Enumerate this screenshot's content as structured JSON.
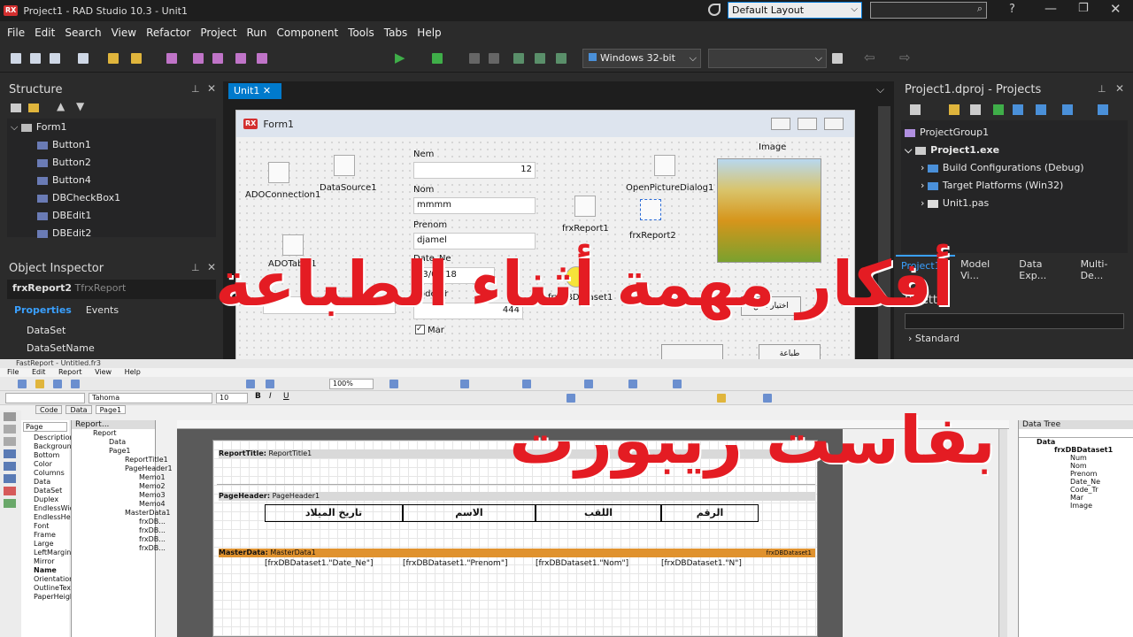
{
  "titlebar": {
    "title": "Project1 - RAD Studio 10.3 - Unit1",
    "logo": "RX",
    "layout": "Default Layout",
    "help": "?"
  },
  "menu": [
    "File",
    "Edit",
    "Search",
    "View",
    "Refactor",
    "Project",
    "Run",
    "Component",
    "Tools",
    "Tabs",
    "Help"
  ],
  "toolbar": {
    "platform": "Windows 32-bit"
  },
  "structure": {
    "title": "Structure",
    "items": [
      "Form1",
      "Button1",
      "Button2",
      "Button4",
      "DBCheckBox1",
      "DBEdit1",
      "DBEdit2"
    ]
  },
  "inspector": {
    "title": "Object Inspector",
    "selected": "frxReport2",
    "selected_type": "TfrxReport",
    "tabs": [
      "Properties",
      "Events"
    ],
    "props": [
      "DataSet",
      "DataSetName"
    ]
  },
  "editor": {
    "tab": "Unit1"
  },
  "form": {
    "title": "Form1",
    "components": {
      "adoconn": "ADOConnection1",
      "datasource": "DataSource1",
      "adotable": "ADOTable1",
      "frxreport1": "frxReport1",
      "frxreport2": "frxReport2",
      "opendlg": "OpenPictureDialog1",
      "dbdataset": "frxDBDataset1",
      "image": "Image"
    },
    "fields": {
      "num_label": "Nem",
      "num_value": "12",
      "nom_label": "Nom",
      "nom_value": "mmmm",
      "prenom_label": "Prenom",
      "prenom_value": "djamel",
      "date_label": "Date_Ne",
      "date_value": "03/04/18",
      "code_label": "Code_Tr",
      "code_value": "444",
      "mar_label": "Mar"
    },
    "buttons": {
      "choose_image": "اختيار الص",
      "print": "طباعة"
    }
  },
  "projects": {
    "title": "Project1.dproj - Projects",
    "items": [
      "ProjectGroup1",
      "Project1.exe",
      "Build Configurations (Debug)",
      "Target Platforms (Win32)",
      "Unit1.pas"
    ],
    "tabs": [
      "Project1...",
      "Model Vi...",
      "Data Exp...",
      "Multi-De..."
    ]
  },
  "palette": {
    "title": "Palette",
    "category": "Standard"
  },
  "overlay": {
    "line1": "أفكار مهمة أثناء الطباعة",
    "line2": "بفاست ريبورت"
  },
  "fastreport": {
    "title": "FastReport - Untitled.fr3",
    "menu": [
      "File",
      "Edit",
      "Report",
      "View",
      "Help"
    ],
    "zoom": "100%",
    "font": "Tahoma",
    "size": "10",
    "tabs": [
      "Code",
      "Data",
      "Page1"
    ],
    "report_tree_title": "Report...",
    "report_tree": [
      "Report",
      "Data",
      "Page1",
      "ReportTitle1",
      "PageHeader1",
      "Memo1",
      "Memo2",
      "Memo3",
      "Memo4",
      "MasterData1",
      "frxDB...",
      "frxDB...",
      "frxDB...",
      "frxDB..."
    ],
    "side_props": [
      "Page",
      "Description",
      "Background",
      "Bottom",
      "Color",
      "Columns",
      "Data",
      "DataSet",
      "Duplex",
      "EndlessWidth",
      "EndlessHeight",
      "Font",
      "Frame",
      "Large",
      "LeftMargin",
      "Mirror",
      "Name",
      "Orientation",
      "OutlineText",
      "PaperHeight"
    ],
    "bands": {
      "title_label": "ReportTitle:",
      "title_name": "ReportTitle1",
      "header_label": "PageHeader:",
      "header_name": "PageHeader1",
      "header_cells": [
        "تاريخ الميلاد",
        "الاسم",
        "اللقب",
        "الرقم"
      ],
      "master_label": "MasterData:",
      "master_name": "MasterData1",
      "master_dataset": "frxDBDataset1",
      "master_cells": [
        "[frxDBDataset1.\"Date_Ne\"]",
        "[frxDBDataset1.\"Prenom\"]",
        "[frxDBDataset1.\"Nom\"]",
        "[frxDBDataset1.\"N\"]"
      ]
    },
    "data_tree_title": "Data Tree",
    "data_tree": [
      "Data",
      "frxDBDataset1",
      "Num",
      "Nom",
      "Prenom",
      "Date_Ne",
      "Code_Tr",
      "Mar",
      "Image"
    ]
  }
}
